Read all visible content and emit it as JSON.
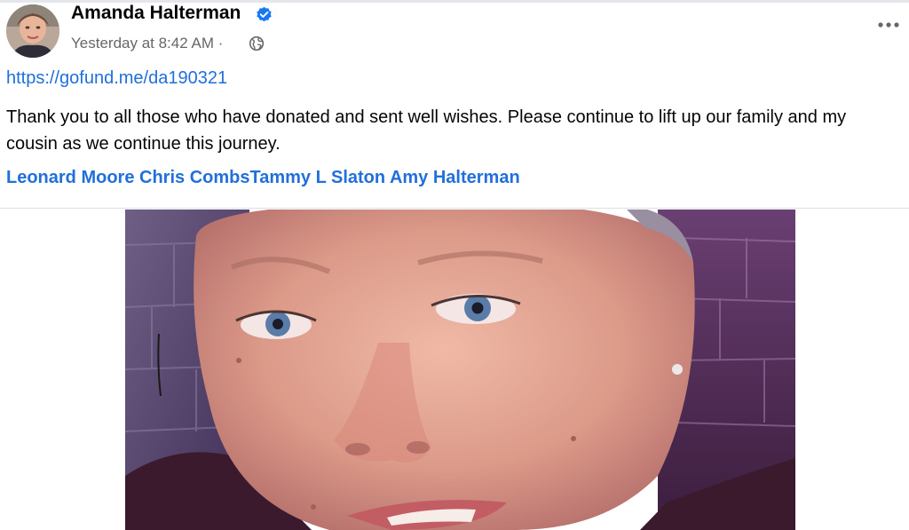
{
  "post": {
    "author": "Amanda Halterman",
    "timestamp": "Yesterday at 8:42 AM",
    "separator": "·",
    "privacy_icon": "globe-icon",
    "verified_icon": "verified-badge-icon",
    "more_icon": "more-options-icon",
    "link": "https://gofund.me/da190321",
    "text": "Thank you to all those who have donated and sent well wishes. Please continue to lift up our family and my cousin as we continue this journey.",
    "tags": [
      {
        "label": "Leonard Moore"
      },
      {
        "label": "Chris Combs"
      },
      {
        "label": "Tammy L Slaton"
      },
      {
        "label": "Amy Halterman"
      }
    ],
    "photo_icon": "portrait-photo"
  },
  "colors": {
    "link": "#216fdb",
    "verified": "#1877f2",
    "meta": "#65676b"
  }
}
